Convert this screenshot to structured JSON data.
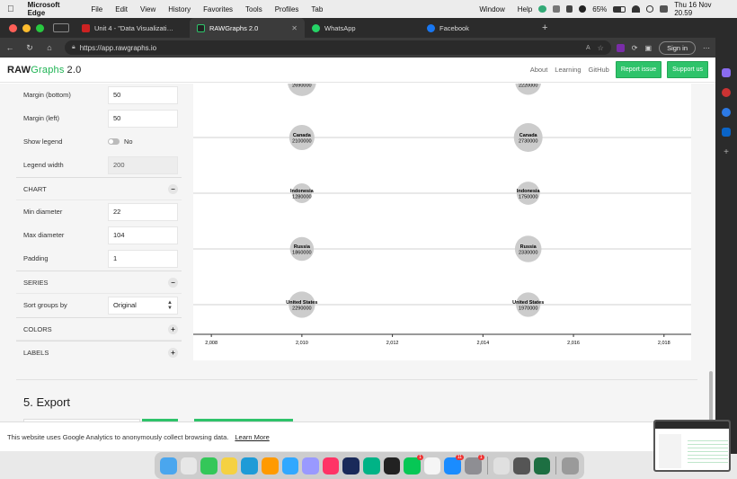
{
  "menubar": {
    "app": "Microsoft Edge",
    "items": [
      "File",
      "Edit",
      "View",
      "History",
      "Favorites",
      "Tools",
      "Profiles",
      "Tab"
    ],
    "right_items": [
      "Window",
      "Help"
    ],
    "battery": "65%",
    "clock": "Thu 16 Nov  20.59"
  },
  "tabs": [
    {
      "title": "Unit 4 - \"Data Visualization an",
      "color": "#cc2222",
      "active": false
    },
    {
      "title": "RAWGraphs 2.0",
      "color": "#111111",
      "active": true
    },
    {
      "title": "WhatsApp",
      "color": "#25d366",
      "active": false
    },
    {
      "title": "Facebook",
      "color": "#1877f2",
      "active": false
    }
  ],
  "address": {
    "url": "https://app.rawgraphs.io",
    "sign_in": "Sign in"
  },
  "app": {
    "logo_raw": "RAW",
    "logo_graphs": "Graphs",
    "logo_version": "2.0",
    "nav": [
      "About",
      "Learning",
      "GitHub"
    ],
    "report_issue": "Report issue",
    "support_us": "Support us"
  },
  "panel": {
    "margin_bottom_label": "Margin (bottom)",
    "margin_bottom_value": "50",
    "margin_left_label": "Margin (left)",
    "margin_left_value": "50",
    "show_legend_label": "Show legend",
    "show_legend_value": "No",
    "legend_width_label": "Legend width",
    "legend_width_value": "200",
    "chart_section": "CHART",
    "min_diameter_label": "Min diameter",
    "min_diameter_value": "22",
    "max_diameter_label": "Max diameter",
    "max_diameter_value": "104",
    "padding_label": "Padding",
    "padding_value": "1",
    "series_section": "SERIES",
    "sort_groups_label": "Sort groups by",
    "sort_groups_value": "Original",
    "colors_section": "COLORS",
    "labels_section": "LABELS",
    "minus": "−",
    "plus": "+"
  },
  "chart_data": {
    "type": "scatter",
    "categories": [
      "Brazil",
      "Canada",
      "Indonesia",
      "Russia",
      "United States"
    ],
    "x_ticks": [
      "2,008",
      "2,010",
      "2,012",
      "2,014",
      "2,016",
      "2,018"
    ],
    "xlim": [
      2007.6,
      2018.6
    ],
    "series": [
      {
        "values": [
          {
            "country": "Brazil",
            "year": 2010,
            "value": 2690000
          },
          {
            "country": "Brazil",
            "year": 2015,
            "value": 2220000
          },
          {
            "country": "Canada",
            "year": 2010,
            "value": 2100000
          },
          {
            "country": "Canada",
            "year": 2015,
            "value": 2730000
          },
          {
            "country": "Indonesia",
            "year": 2010,
            "value": 1280000
          },
          {
            "country": "Indonesia",
            "year": 2015,
            "value": 1750000
          },
          {
            "country": "Russia",
            "year": 2010,
            "value": 1860000
          },
          {
            "country": "Russia",
            "year": 2015,
            "value": 2330000
          },
          {
            "country": "United States",
            "year": 2010,
            "value": 2290000
          },
          {
            "country": "United States",
            "year": 2015,
            "value": 1970000
          }
        ]
      }
    ],
    "bubble_color": "#cccccc"
  },
  "export": {
    "title": "5. Export"
  },
  "cookie": {
    "text": "This website uses Google Analytics to anonymously collect browsing data.",
    "learn_more": "Learn More"
  },
  "dock": {
    "icons": [
      "finder-icon",
      "launchpad-icon",
      "messages-icon",
      "notes-icon",
      "edge-icon",
      "illustrator-icon",
      "photoshop-icon",
      "aftereffects-icon",
      "indesign-icon",
      "cinema4d-icon",
      "feishu-icon",
      "terminal-icon",
      "line-icon",
      "clock-icon",
      "appstore-icon",
      "settings-icon",
      "drive-icon",
      "monitor-icon",
      "excel-icon",
      "trash-icon"
    ],
    "colors": [
      "#4aa6ee",
      "#e7e7e7",
      "#34c759",
      "#f5d142",
      "#1e9bd7",
      "#ff9a00",
      "#31a8ff",
      "#9999ff",
      "#ff3366",
      "#1a2a5a",
      "#00b386",
      "#222222",
      "#06c755",
      "#f5f5f5",
      "#1a8cff",
      "#8e8e93",
      "#e0e0e0",
      "#555555",
      "#1d6f42",
      "#9a9a9a"
    ],
    "line_badge": "1",
    "appstore_badge": "11",
    "settings_badge": "1"
  }
}
